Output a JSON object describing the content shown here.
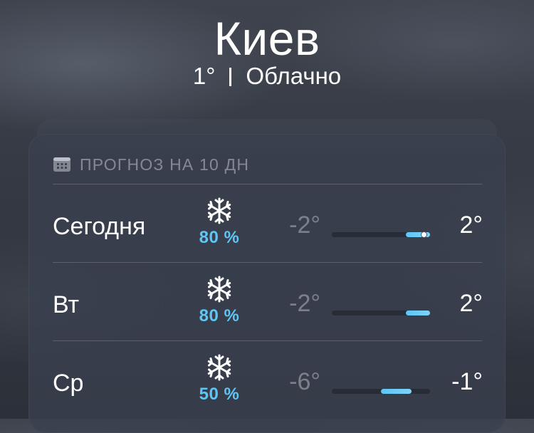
{
  "location": {
    "city": "Киев",
    "current_temp": "1°",
    "condition": "Облачно"
  },
  "forecast": {
    "header": "ПРОГНОЗ НА 10 ДН",
    "header_icon": "calendar-icon",
    "days": [
      {
        "day": "Сегодня",
        "icon": "snowflake-icon",
        "precip": "80 %",
        "precip_chance": 0.8,
        "low": "-2°",
        "high": "2°",
        "range_low": -2,
        "range_high": 2,
        "current_temp": 1
      },
      {
        "day": "Вт",
        "icon": "snowflake-icon",
        "precip": "80 %",
        "precip_chance": 0.8,
        "low": "-2°",
        "high": "2°",
        "range_low": -2,
        "range_high": 2
      },
      {
        "day": "Ср",
        "icon": "snowflake-icon",
        "precip": "50 %",
        "precip_chance": 0.5,
        "low": "-6°",
        "high": "-1°",
        "range_low": -6,
        "range_high": -1
      }
    ]
  },
  "colors": {
    "precip_text": "#5ec6f7",
    "bar_fill": "#5ec6f7",
    "card_background": "#3a404e"
  }
}
